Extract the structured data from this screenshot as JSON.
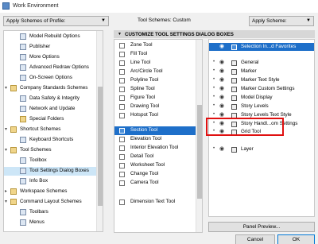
{
  "window": {
    "title": "Work Environment"
  },
  "topbar": {
    "apply_profile_label": "Apply Schemes of Profile:",
    "tool_schemes_label": "Tool Schemes:  Custom",
    "apply_scheme_label": "Apply Scheme:"
  },
  "left_tree": {
    "items": [
      {
        "label": "Model Rebuild Options"
      },
      {
        "label": "Publisher"
      },
      {
        "label": "More Options"
      },
      {
        "label": "Advanced Redraw Options"
      },
      {
        "label": "On-Screen Options"
      },
      {
        "label": "Company Standards Schemes"
      },
      {
        "label": "Data Safety & Integrity"
      },
      {
        "label": "Network and Update"
      },
      {
        "label": "Special Folders"
      },
      {
        "label": "Shortcut Schemes"
      },
      {
        "label": "Keyboard Shortcuts"
      },
      {
        "label": "Tool Schemes"
      },
      {
        "label": "Toolbox"
      },
      {
        "label": "Tool Settings Dialog Boxes"
      },
      {
        "label": "Info Box"
      },
      {
        "label": "Workspace Schemes"
      },
      {
        "label": "Command Layout Schemes"
      },
      {
        "label": "Toolbars"
      },
      {
        "label": "Menus"
      }
    ]
  },
  "section_header": "CUSTOMIZE TOOL SETTINGS DIALOG BOXES",
  "tools": {
    "items": [
      {
        "label": "Zone Tool"
      },
      {
        "label": "Fill Tool"
      },
      {
        "label": "Line Tool"
      },
      {
        "label": "Arc/Circle Tool"
      },
      {
        "label": "Polyline Tool"
      },
      {
        "label": "Spline Tool"
      },
      {
        "label": "Figure Tool"
      },
      {
        "label": "Drawing Tool"
      },
      {
        "label": "Hotspot Tool"
      },
      {
        "label": "Section Tool"
      },
      {
        "label": "Elevation Tool"
      },
      {
        "label": "Interior Elevation Tool"
      },
      {
        "label": "Detail Tool"
      },
      {
        "label": "Worksheet Tool"
      },
      {
        "label": "Change Tool"
      },
      {
        "label": "Camera Tool"
      },
      {
        "label": "Dimension Text Tool"
      }
    ]
  },
  "panels": {
    "items": [
      {
        "label": "Selection In...d Favorites"
      },
      {
        "label": "General"
      },
      {
        "label": "Marker"
      },
      {
        "label": "Marker Text Style"
      },
      {
        "label": "Marker Custom Settings"
      },
      {
        "label": "Model Display"
      },
      {
        "label": "Story Levels"
      },
      {
        "label": "Story Levels Text Style"
      },
      {
        "label": "Story Handl...om Settings"
      },
      {
        "label": "Grid Tool"
      },
      {
        "label": "Layer"
      }
    ]
  },
  "buttons": {
    "panel_preview": "Panel Preview...",
    "cancel": "Cancel",
    "ok": "OK"
  },
  "colors": {
    "selection_blue": "#1e6fc9",
    "highlight_red": "#e01010"
  }
}
